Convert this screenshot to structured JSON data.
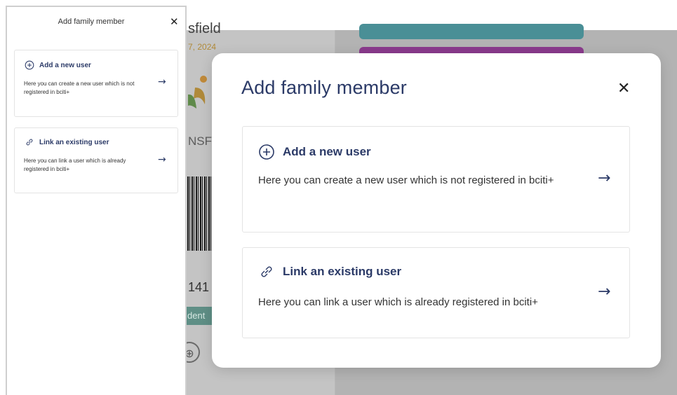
{
  "background": {
    "name_fragment": "sfield",
    "date_fragment": "7, 2024",
    "logo_text_fragment": "NSFI",
    "number_fragment": "141",
    "badge_fragment": "dent",
    "colors": {
      "teal_bar": "#4a8f96",
      "purple_bar": "#8a3b8d"
    }
  },
  "side_panel": {
    "title": "Add family member",
    "close_icon": "close-icon",
    "options": [
      {
        "icon": "plus-circle-icon",
        "title": "Add a new user",
        "description": "Here you can create a new user which is not registered in bciti+",
        "arrow": "→"
      },
      {
        "icon": "link-icon",
        "title": "Link an existing user",
        "description": "Here you can link a user which is already registered in bciti+",
        "arrow": "→"
      }
    ]
  },
  "modal": {
    "title": "Add family member",
    "close_label": "✕",
    "options": [
      {
        "icon": "plus-circle-icon",
        "title": "Add a new user",
        "description": "Here you can create a new user which is not registered in bciti+",
        "arrow": "→"
      },
      {
        "icon": "link-icon",
        "title": "Link an existing user",
        "description": "Here you can link a user which is already registered in bciti+",
        "arrow": "→"
      }
    ]
  },
  "colors": {
    "accent": "#2b3a67",
    "overlay": "#b9b9b9"
  }
}
